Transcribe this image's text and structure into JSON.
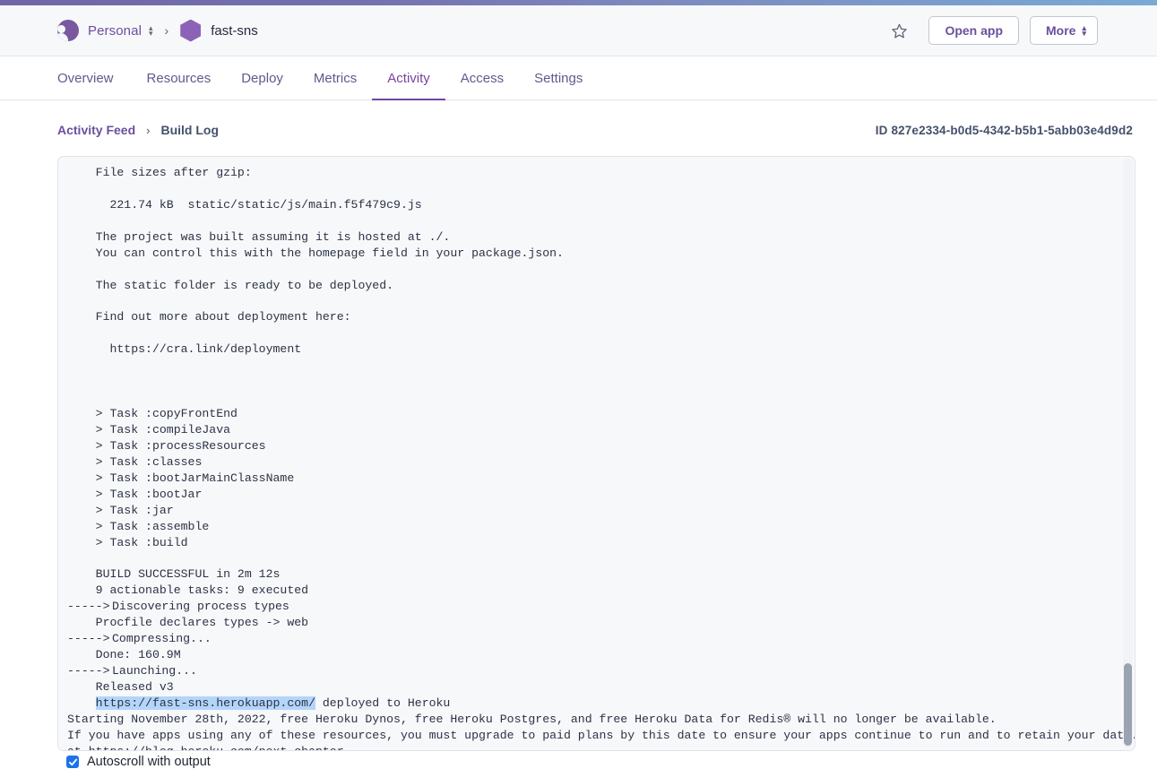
{
  "colors": {
    "gradient_left": "#6e67a8",
    "gradient_right": "#79aad4",
    "accent_purple": "#6b4f9e",
    "active_tab": "#76449d",
    "highlight_blue": "#b4d5fa",
    "checkbox_blue": "#1a73e8"
  },
  "header": {
    "account_name": "Personal",
    "account_switch_icon": "chevron-up-down-icon",
    "breadcrumb_separator": "›",
    "app_name": "fast-sns",
    "app_icon": "hexagon-app-icon",
    "avatar_icon": "user-avatar-icon",
    "star_icon": "star-outline-icon",
    "open_app_label": "Open app",
    "more_label": "More",
    "more_icon": "chevron-up-down-icon"
  },
  "nav": {
    "tabs": [
      {
        "label": "Overview",
        "active": false
      },
      {
        "label": "Resources",
        "active": false
      },
      {
        "label": "Deploy",
        "active": false
      },
      {
        "label": "Metrics",
        "active": false
      },
      {
        "label": "Activity",
        "active": true
      },
      {
        "label": "Access",
        "active": false
      },
      {
        "label": "Settings",
        "active": false
      }
    ]
  },
  "subbar": {
    "breadcrumb_link": "Activity Feed",
    "breadcrumb_separator": "›",
    "breadcrumb_current": "Build Log",
    "build_id": "ID 827e2334-b0d5-4342-b5b1-5abb03e4d9d2"
  },
  "log": {
    "lines": [
      {
        "prefix": "",
        "text": "    File sizes after gzip:"
      },
      {
        "prefix": "",
        "text": ""
      },
      {
        "prefix": "",
        "text": "      221.74 kB  static/static/js/main.f5f479c9.js"
      },
      {
        "prefix": "",
        "text": ""
      },
      {
        "prefix": "",
        "text": "    The project was built assuming it is hosted at ./."
      },
      {
        "prefix": "",
        "text": "    You can control this with the homepage field in your package.json."
      },
      {
        "prefix": "",
        "text": ""
      },
      {
        "prefix": "",
        "text": "    The static folder is ready to be deployed."
      },
      {
        "prefix": "",
        "text": ""
      },
      {
        "prefix": "",
        "text": "    Find out more about deployment here:"
      },
      {
        "prefix": "",
        "text": ""
      },
      {
        "prefix": "",
        "text": "      https://cra.link/deployment"
      },
      {
        "prefix": "",
        "text": ""
      },
      {
        "prefix": "",
        "text": ""
      },
      {
        "prefix": "",
        "text": ""
      },
      {
        "prefix": "",
        "text": "    > Task :copyFrontEnd"
      },
      {
        "prefix": "",
        "text": "    > Task :compileJava"
      },
      {
        "prefix": "",
        "text": "    > Task :processResources"
      },
      {
        "prefix": "",
        "text": "    > Task :classes"
      },
      {
        "prefix": "",
        "text": "    > Task :bootJarMainClassName"
      },
      {
        "prefix": "",
        "text": "    > Task :bootJar"
      },
      {
        "prefix": "",
        "text": "    > Task :jar"
      },
      {
        "prefix": "",
        "text": "    > Task :assemble"
      },
      {
        "prefix": "",
        "text": "    > Task :build"
      },
      {
        "prefix": "",
        "text": ""
      },
      {
        "prefix": "",
        "text": "    BUILD SUCCESSFUL in 2m 12s"
      },
      {
        "prefix": "",
        "text": "    9 actionable tasks: 9 executed"
      },
      {
        "prefix": "-----> ",
        "text": "Discovering process types"
      },
      {
        "prefix": "",
        "text": "    Procfile declares types -> web"
      },
      {
        "prefix": "-----> ",
        "text": "Compressing..."
      },
      {
        "prefix": "",
        "text": "    Done: 160.9M"
      },
      {
        "prefix": "-----> ",
        "text": "Launching..."
      },
      {
        "prefix": "",
        "text": "    Released v3"
      },
      {
        "prefix": "",
        "text": "    ",
        "highlight": "https://fast-sns.herokuapp.com/",
        "suffix": " deployed to Heroku"
      },
      {
        "prefix": "",
        "text": "Starting November 28th, 2022, free Heroku Dynos, free Heroku Postgres, and free Heroku Data for Redis® will no longer be available."
      },
      {
        "prefix": "",
        "text": "If you have apps using any of these resources, you must upgrade to paid plans by this date to ensure your apps continue to run and to retain your data. Learn more"
      },
      {
        "prefix": "",
        "text": "at https://blog.heroku.com/next-chapter"
      }
    ],
    "scrollbar_name": "log-scrollbar"
  },
  "footer": {
    "autoscroll_label": "Autoscroll with output",
    "autoscroll_checked": true
  }
}
